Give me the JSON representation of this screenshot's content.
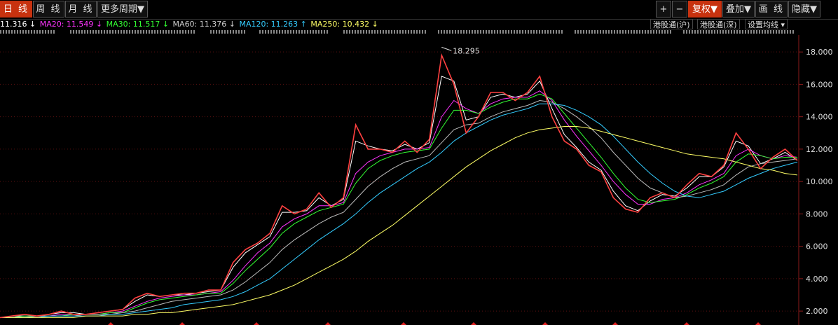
{
  "toolbar": {
    "period_tabs": [
      "日 线",
      "周 线",
      "月 线",
      "更多周期▼"
    ],
    "right_buttons": [
      "+",
      "−",
      "复权▼",
      "叠加▼",
      "画 线",
      "隐藏▼"
    ]
  },
  "ma_legend": [
    {
      "label": "11.316 ↓",
      "color": "#ffffff"
    },
    {
      "label": "MA20: 11.549 ↓",
      "color": "#ff33ff"
    },
    {
      "label": "MA30: 11.517 ↓",
      "color": "#33ff33"
    },
    {
      "label": "MA60: 11.376 ↓",
      "color": "#cccccc"
    },
    {
      "label": "MA120: 11.263 ↑",
      "color": "#33ccff"
    },
    {
      "label": "MA250: 10.432 ↓",
      "color": "#ffff66"
    }
  ],
  "hk_buttons": [
    "港股通(沪)",
    "港股通(深)",
    "设置均线 ▾"
  ],
  "chart_data": {
    "type": "line",
    "y_axis_ticks": [
      "18.000",
      "16.000",
      "14.000",
      "12.000",
      "10.000",
      "8.000",
      "6.000",
      "4.000",
      "2.000"
    ],
    "ylim": [
      1.4,
      18.7
    ],
    "peak_label": "18.295",
    "series": [
      {
        "name": "price",
        "color": "#ff4040",
        "values": [
          1.6,
          1.7,
          1.8,
          1.7,
          1.8,
          2.0,
          1.8,
          1.8,
          1.9,
          2.0,
          2.1,
          2.8,
          3.1,
          2.9,
          3.0,
          3.1,
          3.1,
          3.3,
          3.3,
          5.0,
          5.8,
          6.2,
          6.8,
          8.5,
          8.0,
          8.3,
          9.3,
          8.4,
          9.0,
          13.5,
          12.0,
          12.0,
          11.8,
          12.5,
          11.8,
          12.6,
          17.8,
          16.0,
          13.0,
          14.0,
          15.5,
          15.5,
          15.0,
          15.5,
          16.5,
          14.0,
          12.5,
          12.0,
          11.0,
          10.6,
          9.0,
          8.3,
          8.1,
          9.0,
          9.3,
          9.0,
          9.8,
          10.5,
          10.3,
          11.0,
          13.0,
          12.0,
          10.8,
          11.5,
          12.0,
          11.3
        ]
      },
      {
        "name": "MA5",
        "color": "#ffffff",
        "values": [
          1.6,
          1.7,
          1.7,
          1.7,
          1.8,
          1.9,
          1.9,
          1.8,
          1.9,
          2.0,
          2.1,
          2.6,
          3.0,
          2.9,
          3.0,
          3.0,
          3.1,
          3.2,
          3.3,
          4.7,
          5.6,
          6.1,
          6.6,
          8.1,
          8.1,
          8.2,
          9.0,
          8.5,
          8.9,
          12.5,
          12.2,
          12.0,
          11.9,
          12.3,
          12.0,
          12.4,
          16.5,
          16.2,
          13.8,
          14.0,
          15.2,
          15.4,
          15.2,
          15.4,
          16.2,
          14.5,
          12.9,
          12.1,
          11.2,
          10.7,
          9.4,
          8.5,
          8.2,
          8.8,
          9.2,
          9.1,
          9.6,
          10.3,
          10.3,
          10.9,
          12.5,
          12.2,
          11.1,
          11.4,
          11.8,
          11.3
        ]
      },
      {
        "name": "MA20",
        "color": "#ff33ff",
        "values": [
          1.6,
          1.6,
          1.7,
          1.7,
          1.7,
          1.8,
          1.8,
          1.8,
          1.8,
          1.9,
          2.0,
          2.3,
          2.6,
          2.8,
          2.9,
          3.0,
          3.0,
          3.1,
          3.2,
          3.9,
          4.8,
          5.6,
          6.2,
          7.2,
          7.7,
          8.0,
          8.5,
          8.5,
          8.7,
          10.5,
          11.2,
          11.6,
          11.8,
          12.0,
          12.0,
          12.1,
          14.0,
          15.0,
          14.5,
          14.2,
          14.8,
          15.1,
          15.2,
          15.2,
          15.6,
          15.0,
          13.8,
          12.8,
          11.9,
          11.0,
          10.0,
          9.2,
          8.6,
          8.6,
          8.9,
          9.0,
          9.3,
          9.8,
          10.1,
          10.5,
          11.6,
          12.0,
          11.6,
          11.4,
          11.6,
          11.5
        ]
      },
      {
        "name": "MA30",
        "color": "#33ff33",
        "values": [
          1.6,
          1.6,
          1.7,
          1.7,
          1.7,
          1.7,
          1.8,
          1.8,
          1.8,
          1.9,
          1.9,
          2.2,
          2.5,
          2.7,
          2.8,
          2.9,
          3.0,
          3.1,
          3.1,
          3.7,
          4.5,
          5.2,
          5.9,
          6.8,
          7.4,
          7.8,
          8.2,
          8.4,
          8.6,
          9.9,
          10.8,
          11.3,
          11.6,
          11.8,
          11.9,
          12.0,
          13.3,
          14.4,
          14.4,
          14.2,
          14.6,
          14.9,
          15.1,
          15.1,
          15.4,
          15.1,
          14.2,
          13.3,
          12.4,
          11.5,
          10.5,
          9.6,
          8.9,
          8.7,
          8.8,
          8.9,
          9.2,
          9.6,
          9.9,
          10.3,
          11.2,
          11.7,
          11.6,
          11.4,
          11.5,
          11.5
        ]
      },
      {
        "name": "MA60",
        "color": "#bbbbbb",
        "values": [
          1.6,
          1.6,
          1.6,
          1.7,
          1.7,
          1.7,
          1.7,
          1.8,
          1.8,
          1.8,
          1.9,
          2.0,
          2.2,
          2.4,
          2.6,
          2.7,
          2.8,
          2.9,
          3.0,
          3.3,
          3.8,
          4.4,
          5.0,
          5.8,
          6.4,
          6.9,
          7.4,
          7.8,
          8.1,
          8.9,
          9.7,
          10.3,
          10.8,
          11.2,
          11.4,
          11.6,
          12.4,
          13.2,
          13.5,
          13.6,
          14.0,
          14.3,
          14.5,
          14.7,
          15.0,
          14.9,
          14.5,
          14.0,
          13.4,
          12.7,
          11.8,
          11.0,
          10.2,
          9.6,
          9.3,
          9.0,
          9.1,
          9.3,
          9.5,
          9.8,
          10.4,
          10.9,
          11.1,
          11.2,
          11.3,
          11.4
        ]
      },
      {
        "name": "MA120",
        "color": "#33ccff",
        "values": [
          1.6,
          1.6,
          1.6,
          1.6,
          1.7,
          1.7,
          1.7,
          1.7,
          1.7,
          1.8,
          1.8,
          1.9,
          2.0,
          2.1,
          2.2,
          2.4,
          2.5,
          2.6,
          2.7,
          2.9,
          3.2,
          3.6,
          4.0,
          4.6,
          5.2,
          5.8,
          6.4,
          6.9,
          7.4,
          8.0,
          8.7,
          9.3,
          9.8,
          10.3,
          10.8,
          11.2,
          11.8,
          12.5,
          13.0,
          13.4,
          13.8,
          14.1,
          14.3,
          14.5,
          14.8,
          14.8,
          14.7,
          14.4,
          14.0,
          13.5,
          12.8,
          12.0,
          11.2,
          10.5,
          9.9,
          9.4,
          9.1,
          9.0,
          9.2,
          9.4,
          9.8,
          10.2,
          10.5,
          10.8,
          11.0,
          11.2
        ]
      },
      {
        "name": "MA250",
        "color": "#ffff66",
        "values": [
          1.6,
          1.6,
          1.6,
          1.6,
          1.6,
          1.6,
          1.6,
          1.7,
          1.7,
          1.7,
          1.7,
          1.8,
          1.8,
          1.9,
          1.9,
          2.0,
          2.1,
          2.2,
          2.3,
          2.4,
          2.6,
          2.8,
          3.0,
          3.3,
          3.6,
          4.0,
          4.4,
          4.8,
          5.2,
          5.7,
          6.3,
          6.8,
          7.3,
          7.9,
          8.5,
          9.1,
          9.7,
          10.3,
          10.9,
          11.4,
          11.9,
          12.3,
          12.7,
          13.0,
          13.2,
          13.3,
          13.4,
          13.4,
          13.3,
          13.1,
          12.9,
          12.7,
          12.5,
          12.3,
          12.1,
          11.9,
          11.7,
          11.6,
          11.5,
          11.4,
          11.2,
          11.0,
          10.8,
          10.7,
          10.5,
          10.4
        ]
      }
    ]
  }
}
